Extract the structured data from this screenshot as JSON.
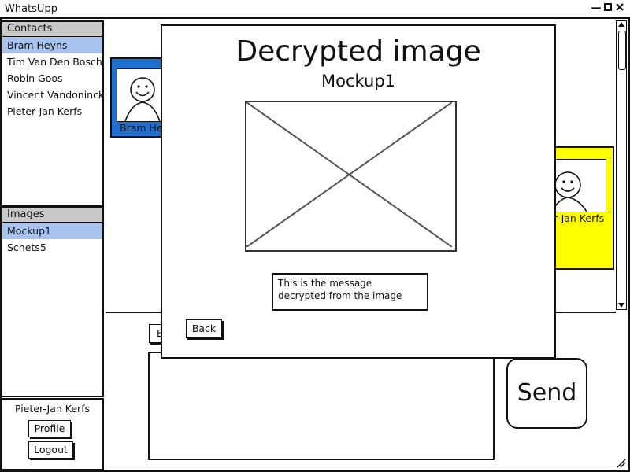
{
  "app": {
    "title": "WhatsUpp",
    "minimize_glyph": "—",
    "maximize_glyph": "▢",
    "close_glyph": "✕"
  },
  "contacts": {
    "header": "Contacts",
    "items": [
      {
        "label": "Bram Heyns",
        "selected": true
      },
      {
        "label": "Tim Van Den Bosch",
        "selected": false
      },
      {
        "label": "Robin Goos",
        "selected": false
      },
      {
        "label": "Vincent Vandoninck",
        "selected": false
      },
      {
        "label": "Pieter-Jan Kerfs",
        "selected": false
      }
    ]
  },
  "images": {
    "header": "Images",
    "items": [
      {
        "label": "Mockup1",
        "selected": true
      },
      {
        "label": "Schets5",
        "selected": false
      }
    ]
  },
  "user_panel": {
    "name": "Pieter-Jan Kerfs",
    "profile_label": "Profile",
    "logout_label": "Logout"
  },
  "conversation": {
    "left_card_label": "Bram Heyns",
    "right_card_label": "Pieter-Jan Kerfs",
    "send_label": "Send",
    "hidden_button_fragment": "B"
  },
  "modal": {
    "title": "Decrypted image",
    "subtitle": "Mockup1",
    "message": "This is the message decrypted from the image",
    "back_label": "Back"
  },
  "colors": {
    "selected_bg": "#a7c3ee",
    "header_bg": "#c8c8c8",
    "left_card_bg": "#1f6fd1",
    "right_card_bg": "#ffff00"
  },
  "icons": {
    "avatar": "smiley-face-icon",
    "image_placeholder": "image-placeholder-icon",
    "resize": "resize-grip-icon"
  }
}
